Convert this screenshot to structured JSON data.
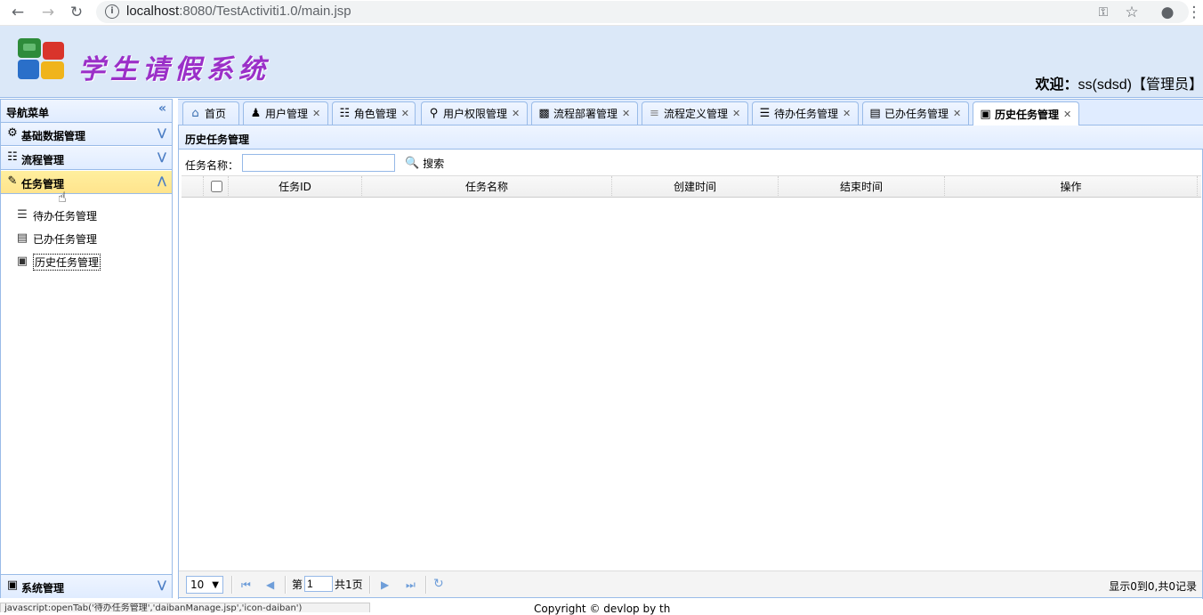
{
  "browser": {
    "url_host": "localhost",
    "url_path": ":8080/TestActiviti1.0/main.jsp"
  },
  "header": {
    "title": "学生请假系统",
    "welcome_prefix": "欢迎：",
    "welcome_user": "ss(sdsd)【管理员】"
  },
  "sidebar": {
    "title": "导航菜单",
    "collapse_icon": "«",
    "sections": [
      {
        "label": "基础数据管理",
        "icon": "gear-icon"
      },
      {
        "label": "流程管理",
        "icon": "org-chart-icon"
      },
      {
        "label": "任务管理",
        "icon": "edit-icon"
      }
    ],
    "items": [
      {
        "label": "待办任务管理"
      },
      {
        "label": "已办任务管理"
      },
      {
        "label": "历史任务管理"
      }
    ],
    "bottom_section": {
      "label": "系统管理"
    }
  },
  "tabs": [
    {
      "label": "首页"
    },
    {
      "label": "用户管理"
    },
    {
      "label": "角色管理"
    },
    {
      "label": "用户权限管理"
    },
    {
      "label": "流程部署管理"
    },
    {
      "label": "流程定义管理"
    },
    {
      "label": "待办任务管理"
    },
    {
      "label": "已办任务管理"
    },
    {
      "label": "历史任务管理"
    }
  ],
  "panel": {
    "title": "历史任务管理",
    "search_label": "任务名称：",
    "search_value": "",
    "search_button": "搜索"
  },
  "grid": {
    "columns": [
      "任务ID",
      "任务名称",
      "创建时间",
      "结束时间",
      "操作"
    ],
    "rows": []
  },
  "pager": {
    "page_size": "10",
    "page_prefix": "第",
    "page_value": "1",
    "page_total": "共1页",
    "info": "显示0到0,共0记录"
  },
  "statusbar": {
    "text": "javascript:openTab('待办任务管理','daibanManage.jsp','icon-daiban')"
  },
  "footer": {
    "text": "Copyright © devlop by th"
  },
  "colors": {
    "border": "#99bbe8",
    "header_bg": "#dbe8f8",
    "active_section": "#ffe48d",
    "title_purple": "#9b30c8"
  }
}
